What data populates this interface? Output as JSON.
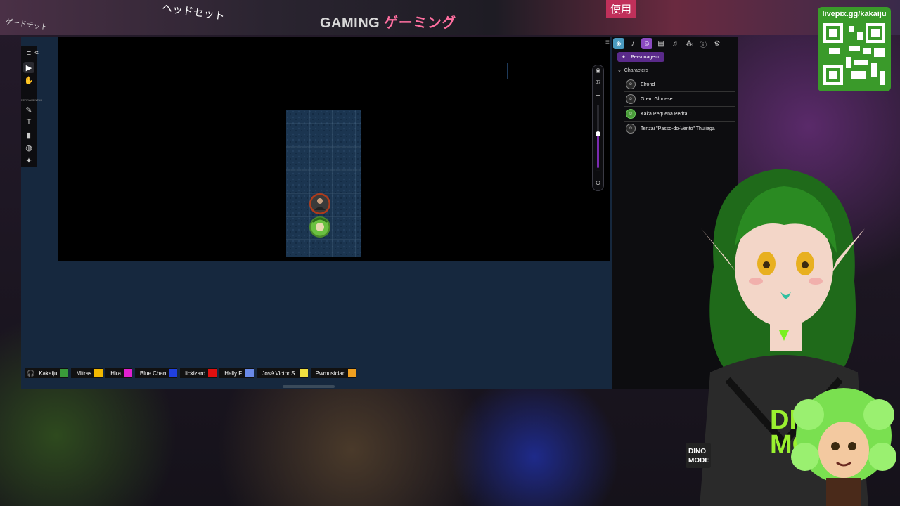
{
  "stream": {
    "qr_url": "livepix.gg/kakaiju",
    "sign_gaming": "GAMING",
    "sign_gaming_jp": "ゲーミング",
    "sign_headset_jp": "ヘッドセット",
    "sign_corner_jp": "ゲードテット",
    "sign_use_jp": "使用",
    "badge_text": "DINO MODE"
  },
  "toolbar": {
    "collapse": "«",
    "tool_label_small": "FERRAMENTAS",
    "tools": [
      "menu-icon",
      "select-icon",
      "pan-icon",
      "brush-icon",
      "text-icon",
      "ruler-icon",
      "palette-icon",
      "fx-icon",
      "wand-icon"
    ]
  },
  "zoom": {
    "value": "87",
    "plus": "+",
    "minus": "−",
    "level": 0.55
  },
  "right_panel": {
    "collapse": "≡",
    "tabs": [
      "scene-icon",
      "sound-icon",
      "character-icon",
      "library-icon",
      "music-icon",
      "nodes-icon",
      "info-icon",
      "settings-icon"
    ],
    "add_label": "Personagem",
    "add_plus": "+",
    "folder_label": "Characters",
    "characters": [
      {
        "name": "Elrond"
      },
      {
        "name": "Grem Glunese"
      },
      {
        "name": "Kaka Pequena Pedra"
      },
      {
        "name": "Tenzai \"Passo-do-Vento\" Thuliaga"
      }
    ]
  },
  "players": [
    {
      "name": "Kakaiju",
      "color": "#3a9a3a"
    },
    {
      "name": "Mitras",
      "color": "#f2b800"
    },
    {
      "name": "Hira",
      "color": "#e020d0"
    },
    {
      "name": "Blue Chan",
      "color": "#2040e0"
    },
    {
      "name": "lickizard",
      "color": "#e01010"
    },
    {
      "name": "Helly F.",
      "color": "#6a8ae8"
    },
    {
      "name": "José Victor S.",
      "color": "#f0e040"
    },
    {
      "name": "Pwmusician",
      "color": "#f0a020"
    }
  ],
  "colors": {
    "accent": "#5a2a8a",
    "map_bg": "#16283e",
    "qr": "#3a9a2a"
  }
}
